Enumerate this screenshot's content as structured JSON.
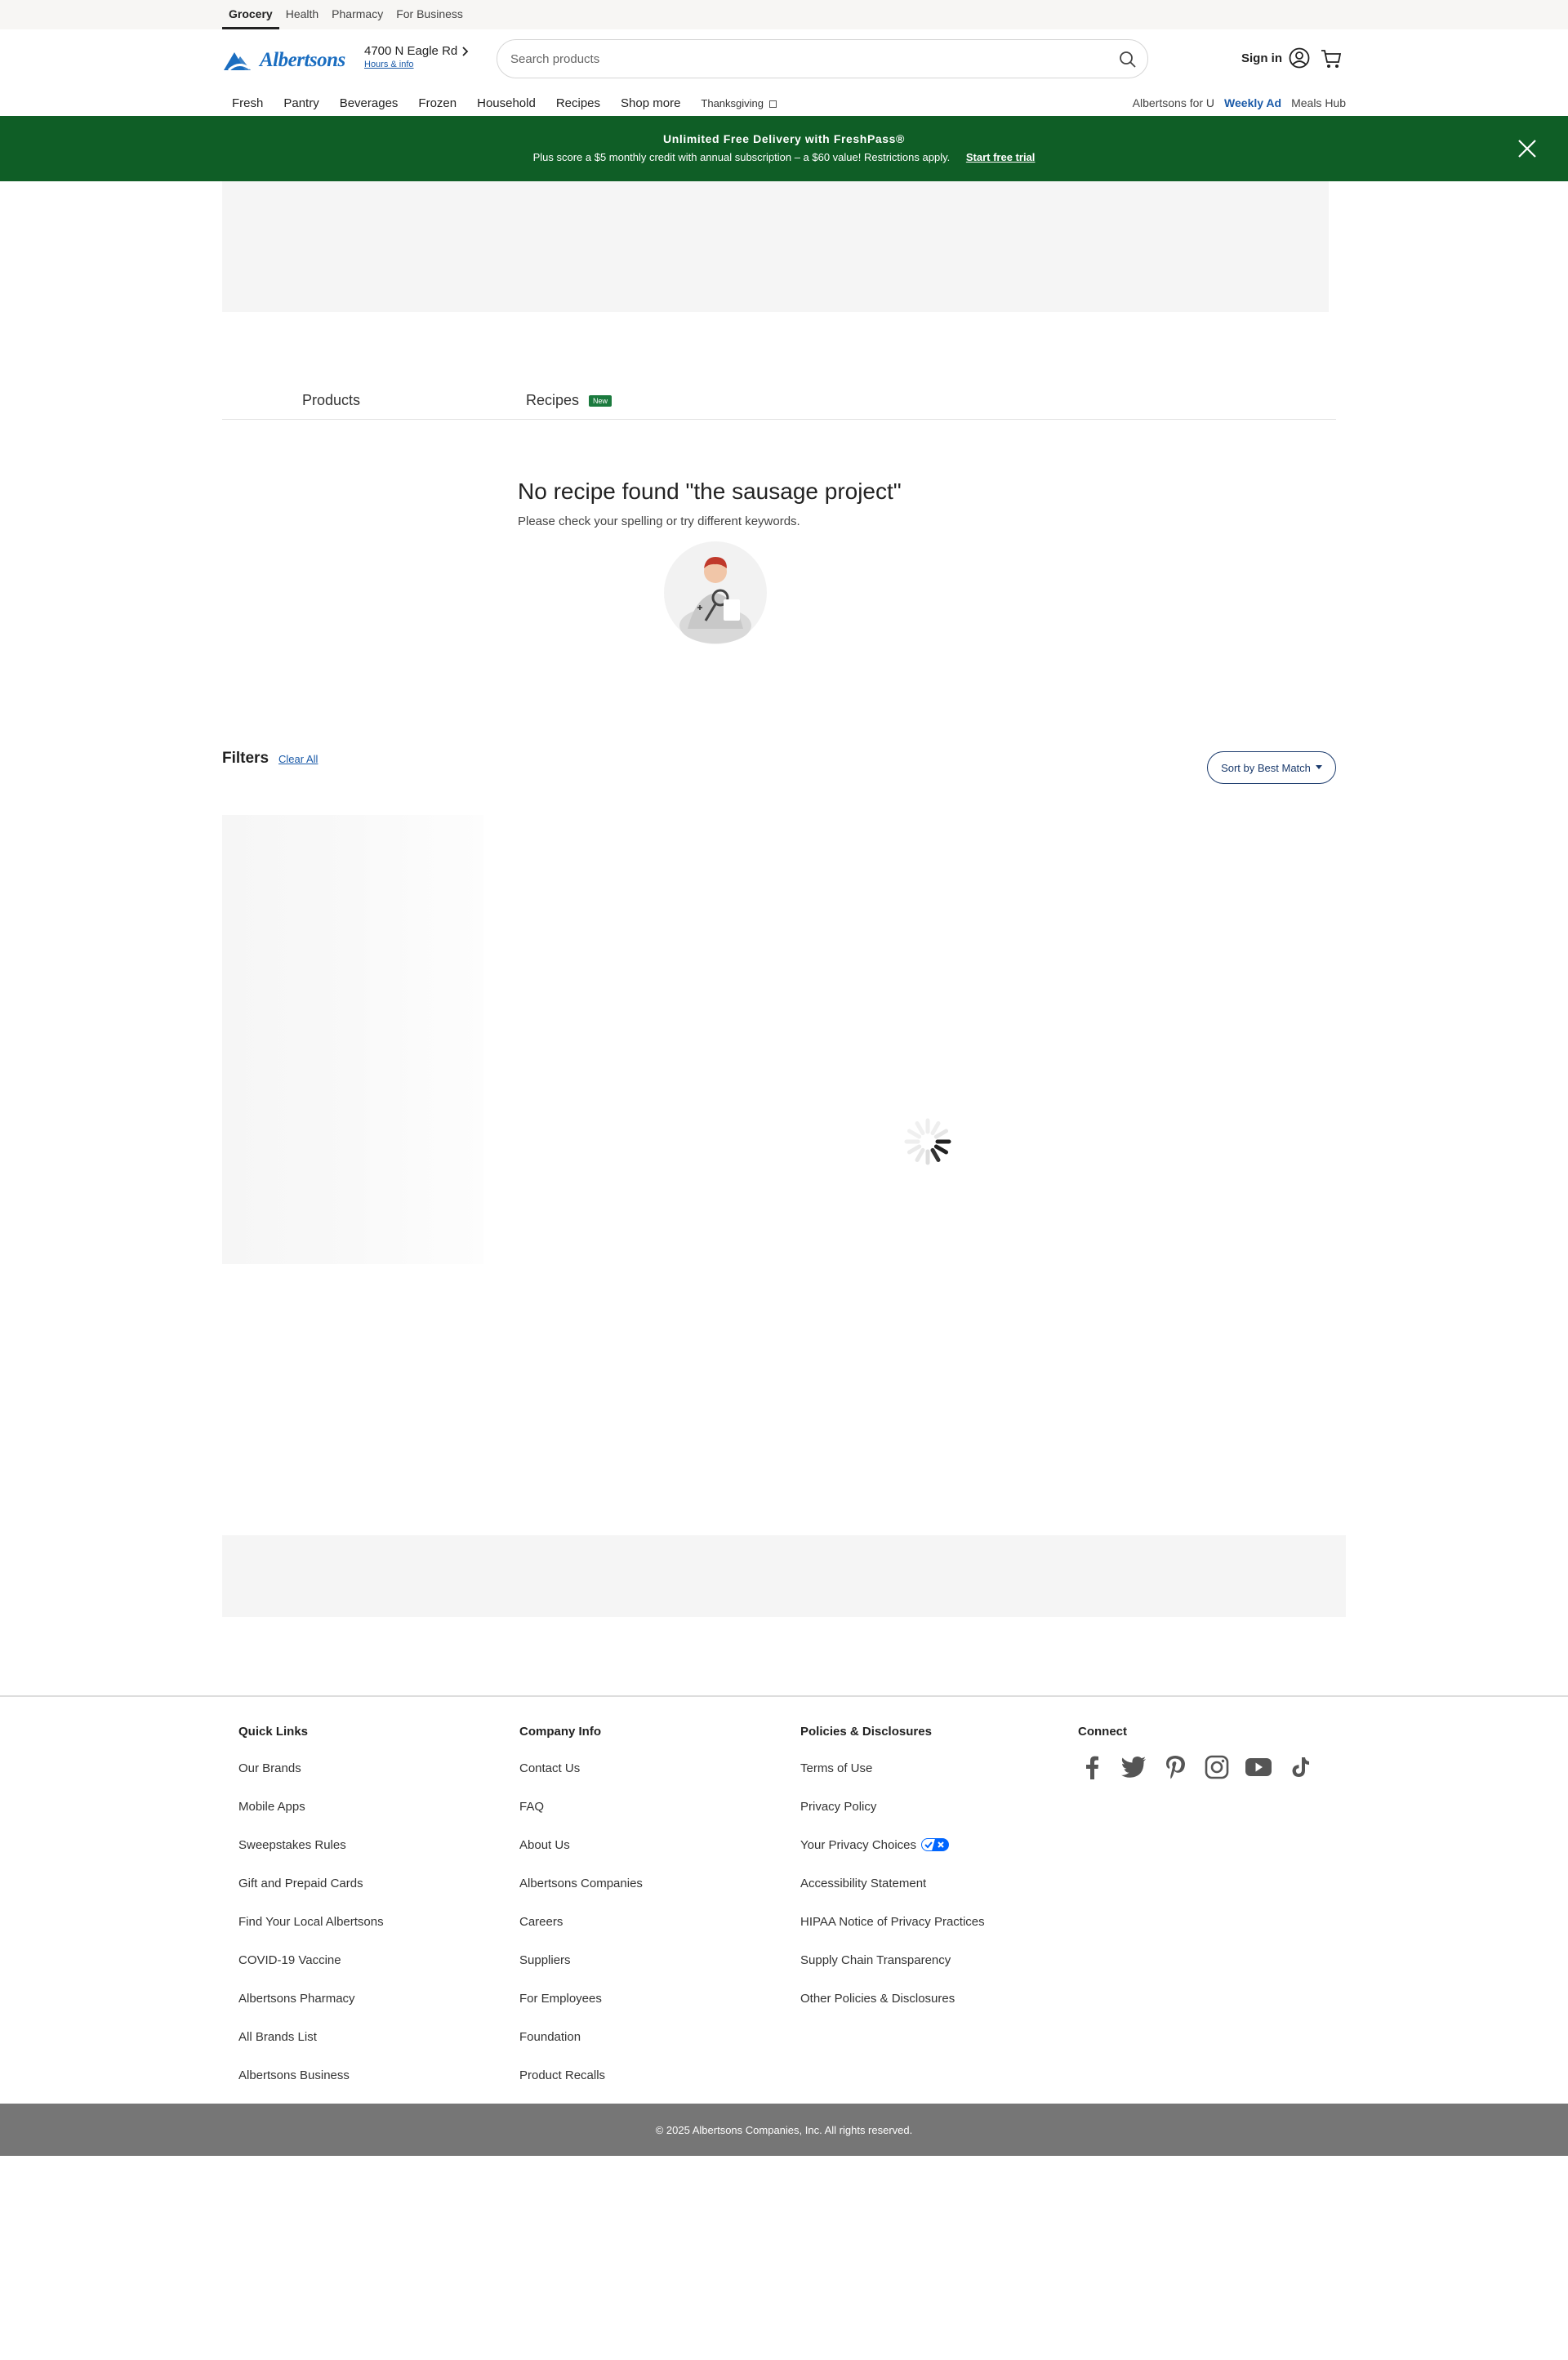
{
  "topbar": {
    "tabs": [
      {
        "label": "Grocery",
        "active": true
      },
      {
        "label": "Health",
        "active": false
      },
      {
        "label": "Pharmacy",
        "active": false
      },
      {
        "label": "For Business",
        "active": false
      }
    ]
  },
  "header": {
    "logo_text": "Albertsons",
    "store_address": "4700 N Eagle Rd",
    "hours_link": "Hours & info",
    "search_placeholder": "Search products",
    "signin_label": "Sign in",
    "brand_color": "#1a6dc0"
  },
  "nav": {
    "items": [
      "Fresh",
      "Pantry",
      "Beverages",
      "Frozen",
      "Household",
      "Recipes",
      "Shop more"
    ],
    "seasonal": "Thanksgiving",
    "right_links": [
      "Albertsons for U",
      "Weekly Ad",
      "Meals Hub"
    ]
  },
  "promo": {
    "title": "Unlimited Free Delivery with FreshPass®",
    "subtitle": "Plus score a $5 monthly credit with annual subscription – a $60 value! Restrictions apply.",
    "cta": "Start free trial",
    "bg_color": "#0f5e26"
  },
  "results": {
    "tabs": {
      "products": "Products",
      "recipes": "Recipes",
      "new_badge": "New"
    },
    "empty_title": "No recipe found \"the sausage project\"",
    "empty_hint": "Please check your spelling or try different keywords."
  },
  "filters": {
    "title": "Filters",
    "clear_all": "Clear All",
    "sort_label": "Sort by Best Match"
  },
  "footer": {
    "quick_links": {
      "title": "Quick Links",
      "items": [
        "Our Brands",
        "Mobile Apps",
        "Sweepstakes Rules",
        "Gift and Prepaid Cards",
        "Find Your Local Albertsons",
        "COVID-19 Vaccine",
        "Albertsons Pharmacy",
        "All Brands List",
        "Albertsons Business"
      ]
    },
    "company_info": {
      "title": "Company Info",
      "items": [
        "Contact Us",
        "FAQ",
        "About Us",
        "Albertsons Companies",
        "Careers",
        "Suppliers",
        "For Employees",
        "Foundation",
        "Product Recalls"
      ]
    },
    "policies": {
      "title": "Policies & Disclosures",
      "items": [
        "Terms of Use",
        "Privacy Policy",
        "Your Privacy Choices",
        "Accessibility Statement",
        "HIPAA Notice of Privacy Practices",
        "Supply Chain Transparency",
        "Other Policies & Disclosures"
      ]
    },
    "connect": {
      "title": "Connect",
      "icons": [
        "facebook-icon",
        "twitter-icon",
        "pinterest-icon",
        "instagram-icon",
        "youtube-icon",
        "tiktok-icon"
      ]
    },
    "copyright": "© 2025 Albertsons Companies, Inc.  All rights reserved."
  }
}
